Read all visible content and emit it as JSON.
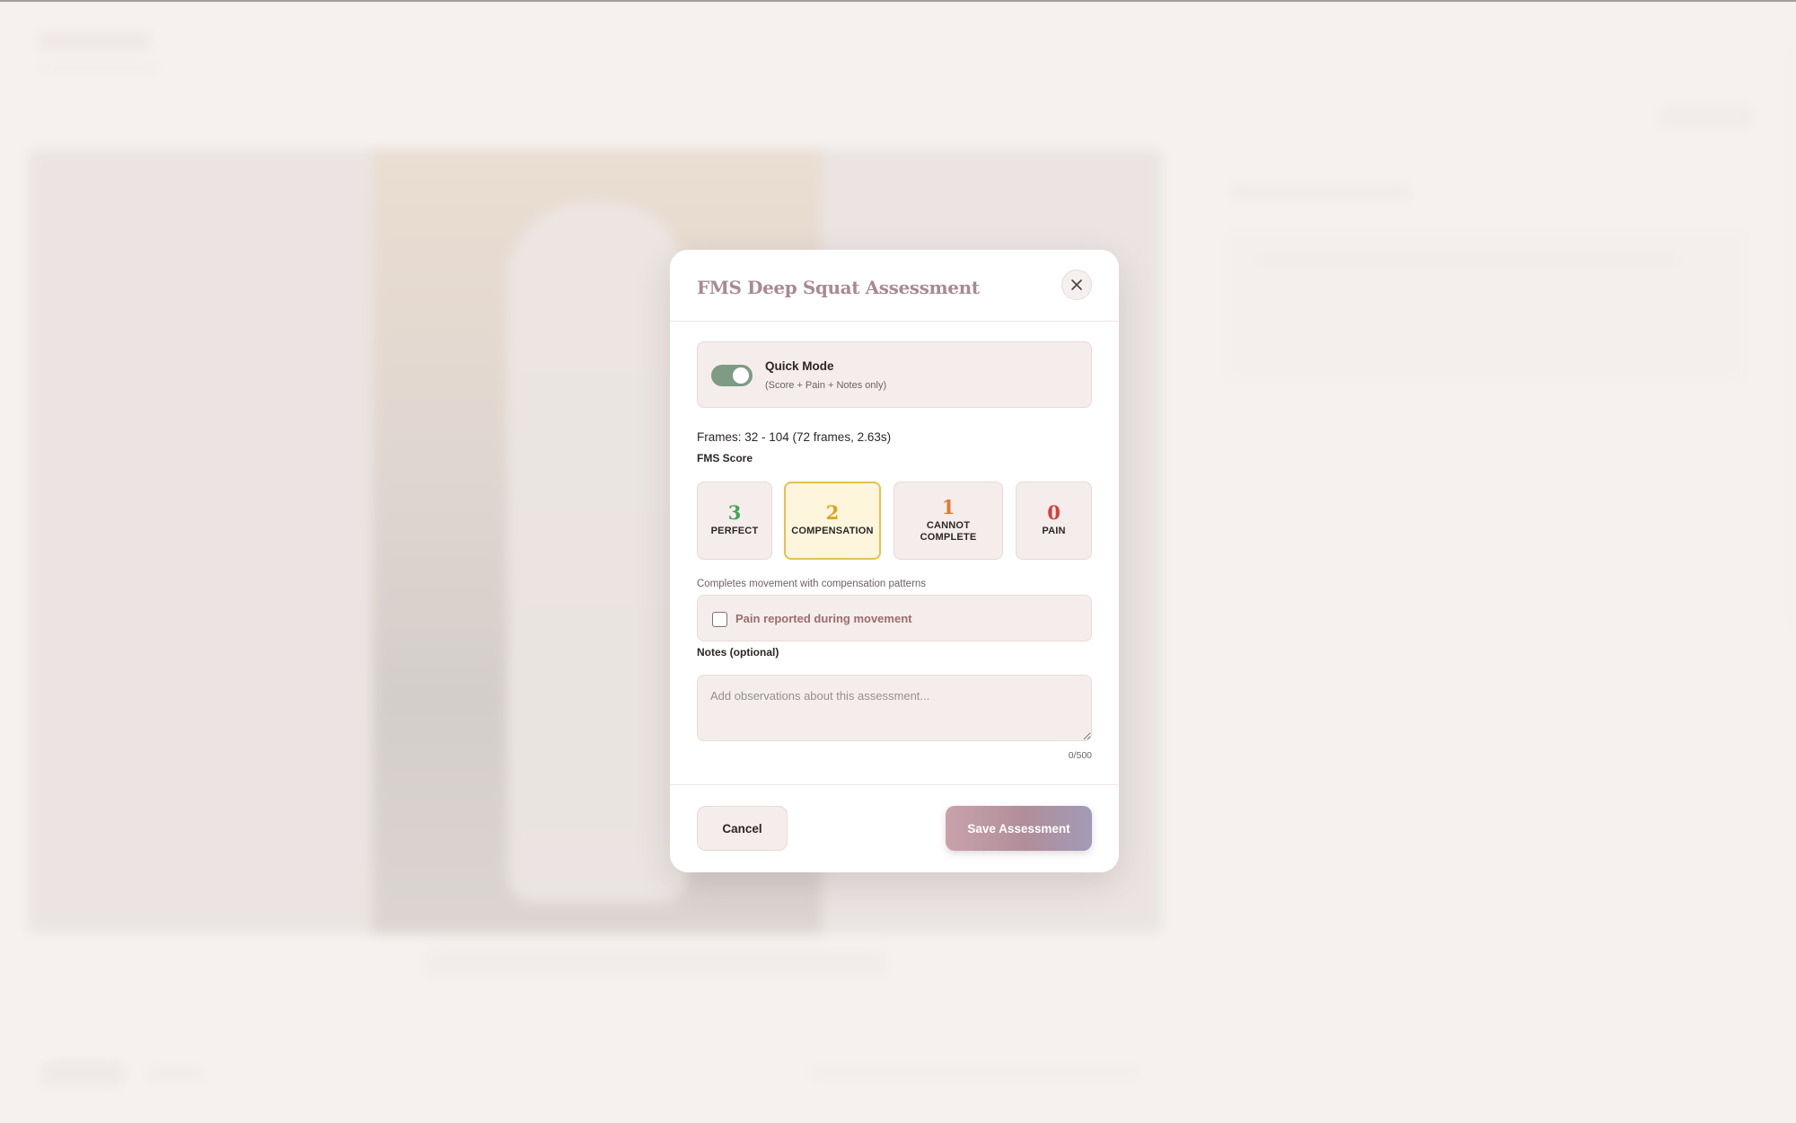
{
  "modal": {
    "title": "FMS Deep Squat Assessment",
    "close_icon": "close-icon",
    "quick_mode": {
      "label": "Quick Mode",
      "sublabel": "(Score + Pain + Notes only)",
      "enabled": true
    },
    "frames_info": "Frames: 32 - 104 (72 frames, 2.63s)",
    "score_section_label": "FMS Score",
    "scores": [
      {
        "value": "3",
        "label": "PERFECT",
        "color": "#3fa55a",
        "selected": false
      },
      {
        "value": "2",
        "label": "COMPENSATION",
        "color": "#e0a21c",
        "selected": true
      },
      {
        "value": "1",
        "label": "CANNOT COMPLETE",
        "color": "#e07a2b",
        "selected": false
      },
      {
        "value": "0",
        "label": "PAIN",
        "color": "#d93b3b",
        "selected": false
      }
    ],
    "score_description": "Completes movement with compensation patterns",
    "pain_checkbox": {
      "label": "Pain reported during movement",
      "checked": false
    },
    "notes": {
      "label": "Notes (optional)",
      "placeholder": "Add observations about this assessment...",
      "value": "",
      "counter": "0/500"
    },
    "buttons": {
      "cancel": "Cancel",
      "save": "Save Assessment"
    }
  },
  "colors": {
    "accent": "#b08e99",
    "toggle_on": "#7e9b83",
    "selected_border": "#e8c04a",
    "selected_bg": "#fdf6dd"
  }
}
